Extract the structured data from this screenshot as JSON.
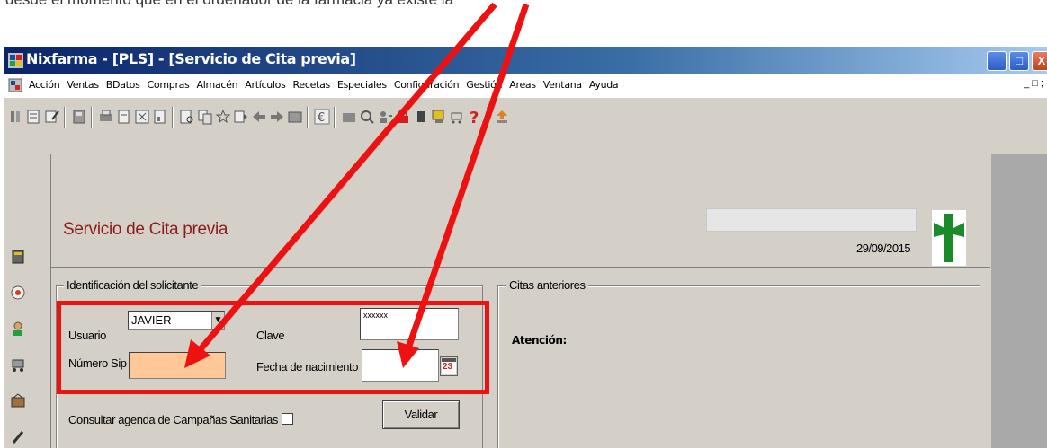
{
  "doc_text": "desde el momento que en el ordenador de la farmacia ya existe la",
  "window": {
    "title": "Nixfarma - [PLS] - [Servicio de Cita previa]",
    "buttons": {
      "minimize": "_",
      "maximize": "□",
      "close": "X"
    }
  },
  "menu": {
    "items": [
      {
        "label": "Acción"
      },
      {
        "label": "Ventas"
      },
      {
        "label": "BDatos"
      },
      {
        "label": "Compras"
      },
      {
        "label": "Almacén"
      },
      {
        "label": "Artículos"
      },
      {
        "label": "Recetas"
      },
      {
        "label": "Especiales"
      },
      {
        "label": "Configuración"
      },
      {
        "label": "Gestión"
      },
      {
        "label": "Areas"
      },
      {
        "label": "Ventana"
      },
      {
        "label": "Ayuda"
      }
    ],
    "mdi_controls": "_ □ ;"
  },
  "form": {
    "title": "Servicio de Cita previa",
    "date": "29/09/2015",
    "solicitante": {
      "legend": "Identificación del solicitante",
      "usuario_label": "Usuario",
      "usuario_value": "JAVIER",
      "clave_label": "Clave",
      "clave_value": "xxxxxx",
      "sip_label": "Número Sip",
      "sip_value": "",
      "fecha_label": "Fecha de nacimiento",
      "fecha_value": "",
      "calendar_text": "23"
    },
    "campanas_label": "Consultar agenda de Campañas Sanitarias",
    "validar_label": "Validar",
    "citas": {
      "legend": "Citas anteriores",
      "atencion_label": "Atención:"
    }
  },
  "colors": {
    "annotation_red": "#ee1111",
    "title_red": "#8b1c1c",
    "sip_field": "#ffc896",
    "cross_green": "#1a8a2a"
  }
}
